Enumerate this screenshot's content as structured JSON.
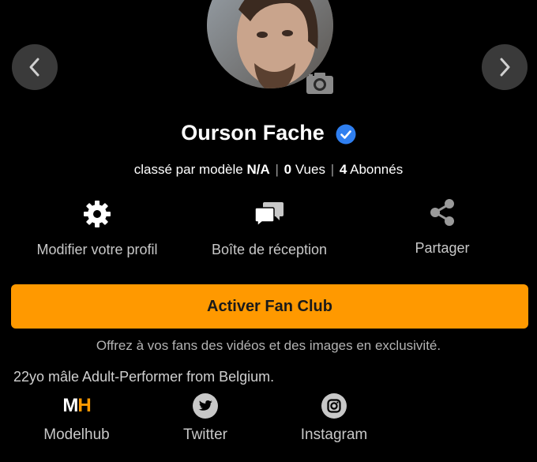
{
  "profile": {
    "name": "Ourson Fache",
    "stats": {
      "rank_prefix": "classé par modèle",
      "rank_value": "N/A",
      "views_value": "0",
      "views_label": "Vues",
      "subs_value": "4",
      "subs_label": "Abonnés"
    },
    "bio": "22yo mâle Adult-Performer from Belgium."
  },
  "actions": {
    "edit_label": "Modifier votre profil",
    "inbox_label": "Boîte de réception",
    "share_label": "Partager"
  },
  "fan_club": {
    "button_label": "Activer Fan Club",
    "note": "Offrez à vos fans des vidéos et des images en exclusivité."
  },
  "social": {
    "modelhub_logo_m": "M",
    "modelhub_logo_h": "H",
    "modelhub_label": "Modelhub",
    "twitter_label": "Twitter",
    "instagram_label": "Instagram"
  },
  "colors": {
    "background": "#000000",
    "accent": "#ff9900",
    "verified": "#2f7ff0"
  },
  "icons": [
    "chevron-left-icon",
    "chevron-right-icon",
    "camera-icon",
    "verified-check-icon",
    "gear-icon",
    "chat-bubbles-icon",
    "share-icon",
    "twitter-icon",
    "instagram-icon"
  ]
}
